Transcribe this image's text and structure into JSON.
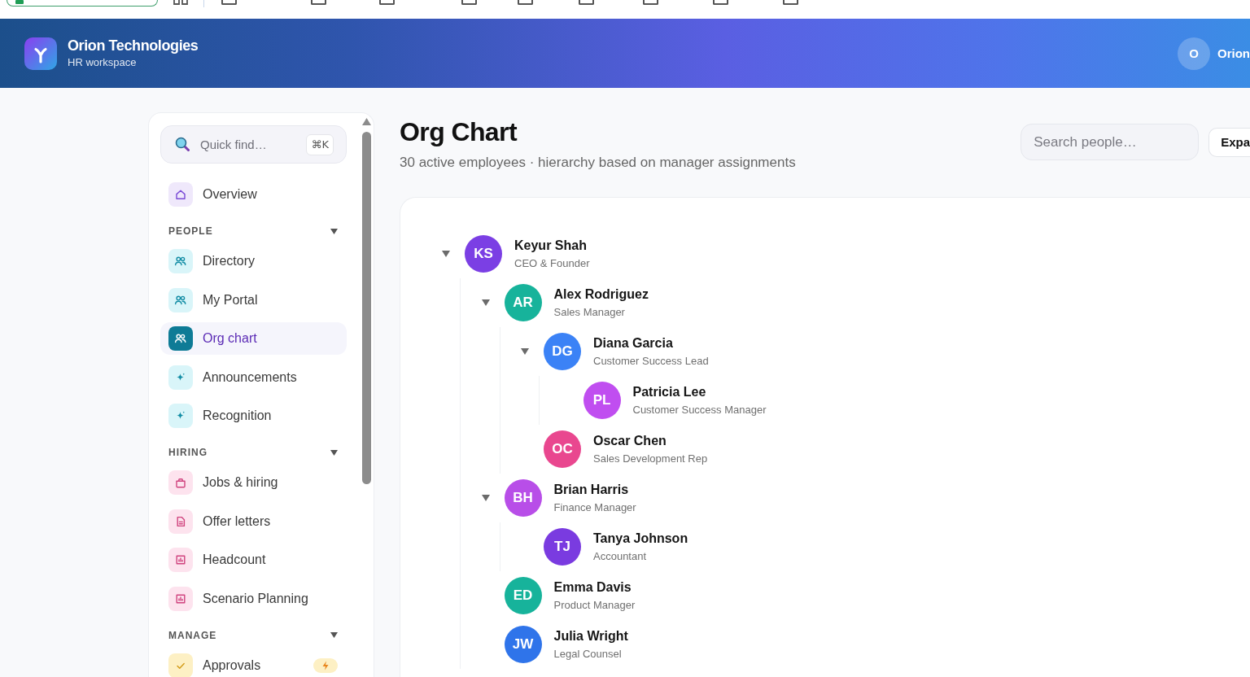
{
  "header": {
    "org_name": "Orion Technologies",
    "workspace": "HR workspace",
    "user": {
      "initials": "O",
      "name": "Orion"
    }
  },
  "sidebar": {
    "quick_find": {
      "placeholder": "Quick find…",
      "shortcut": "⌘K"
    },
    "top_items": [
      {
        "label": "Overview",
        "selected": false,
        "alert": false
      }
    ],
    "sections": [
      {
        "title": "PEOPLE",
        "expanded": true,
        "items": [
          {
            "label": "Directory",
            "selected": false,
            "alert": false
          },
          {
            "label": "My Portal",
            "selected": false,
            "alert": false
          },
          {
            "label": "Org chart",
            "selected": true,
            "alert": false
          },
          {
            "label": "Announcements",
            "selected": false,
            "alert": false
          },
          {
            "label": "Recognition",
            "selected": false,
            "alert": false
          }
        ]
      },
      {
        "title": "HIRING",
        "expanded": true,
        "items": [
          {
            "label": "Jobs & hiring",
            "selected": false,
            "alert": false
          },
          {
            "label": "Offer letters",
            "selected": false,
            "alert": false
          },
          {
            "label": "Headcount",
            "selected": false,
            "alert": false
          },
          {
            "label": "Scenario Planning",
            "selected": false,
            "alert": false
          }
        ]
      },
      {
        "title": "MANAGE",
        "expanded": true,
        "items": [
          {
            "label": "Approvals",
            "selected": false,
            "alert": true
          }
        ]
      }
    ]
  },
  "page": {
    "title": "Org Chart",
    "subtitle": "30 active employees · hierarchy based on manager assignments",
    "search": {
      "placeholder": "Search people…"
    },
    "expand_button": "Expa"
  },
  "org_tree": [
    {
      "initials": "KS",
      "name": "Keyur Shah",
      "title": "CEO & Founder",
      "color": "#7b3fe4",
      "expanded": true,
      "children": [
        {
          "initials": "AR",
          "name": "Alex Rodriguez",
          "title": "Sales Manager",
          "color": "#17b39b",
          "expanded": true,
          "children": [
            {
              "initials": "DG",
              "name": "Diana Garcia",
              "title": "Customer Success Lead",
              "color": "#3b82f6",
              "expanded": true,
              "children": [
                {
                  "initials": "PL",
                  "name": "Patricia Lee",
                  "title": "Customer Success Manager",
                  "color": "#c04ef0"
                }
              ]
            },
            {
              "initials": "OC",
              "name": "Oscar Chen",
              "title": "Sales Development Rep",
              "color": "#e9478f"
            }
          ]
        },
        {
          "initials": "BH",
          "name": "Brian Harris",
          "title": "Finance Manager",
          "color": "#b84ee8",
          "expanded": true,
          "children": [
            {
              "initials": "TJ",
              "name": "Tanya Johnson",
              "title": "Accountant",
              "color": "#7a3be0"
            }
          ]
        },
        {
          "initials": "ED",
          "name": "Emma Davis",
          "title": "Product Manager",
          "color": "#17b39b"
        },
        {
          "initials": "JW",
          "name": "Julia Wright",
          "title": "Legal Counsel",
          "color": "#2f74ea"
        }
      ]
    }
  ]
}
